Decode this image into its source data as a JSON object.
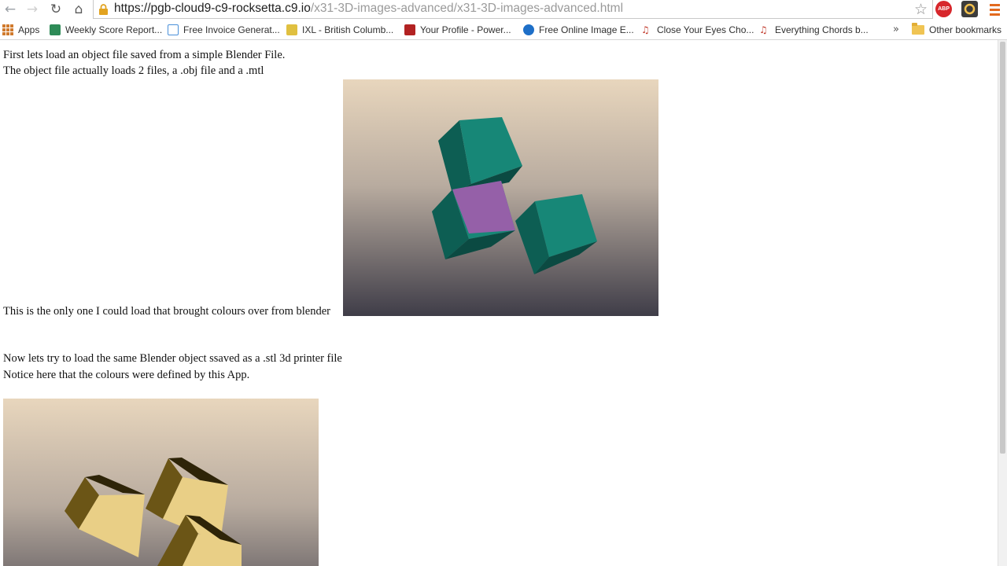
{
  "browser": {
    "url_host": "https://pgb-cloud9-c9-rocksetta.c9.io",
    "url_path": "/x31-3D-images-advanced/x31-3D-images-advanced.html",
    "abp_label": "ABP"
  },
  "bookmarks": {
    "apps_label": "Apps",
    "items": [
      {
        "label": "Weekly Score Report...",
        "color": "#2e8b57"
      },
      {
        "label": "Free Invoice Generat...",
        "color": "#4a90d9"
      },
      {
        "label": "IXL - British Columb...",
        "color": "#e0c040"
      },
      {
        "label": "Your Profile - Power...",
        "color": "#b22222"
      },
      {
        "label": "Free Online Image E...",
        "color": "#1e6fc8"
      },
      {
        "label": "Close Your Eyes Cho...",
        "color": "#c0392b"
      },
      {
        "label": "Everything Chords b...",
        "color": "#c0392b"
      }
    ],
    "overflow": "»",
    "other_label": "Other bookmarks"
  },
  "page": {
    "line1": "First lets load an object file saved from a simple Blender File.",
    "line2": "The object file actually loads 2 files, a .obj file and a .mtl",
    "line3": "This is the only one I could load that brought colours over from blender",
    "line4": "Now lets try to load the same Blender object ssaved as a .stl 3d printer file",
    "line5": "Notice here that the colours were defined by this App."
  },
  "colors": {
    "teal_top": "#178777",
    "teal_left": "#0d5e53",
    "teal_right": "#0b4a42",
    "purple": "#9560a8",
    "tan_top": "#e9cf86",
    "tan_left": "#d9bd70",
    "tan_right": "#6b5516"
  }
}
